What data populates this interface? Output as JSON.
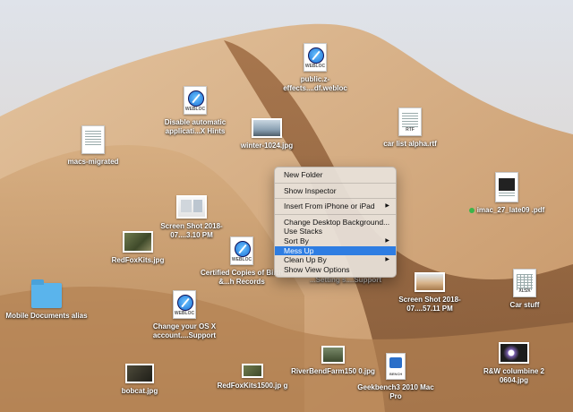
{
  "desktop": {
    "icons": [
      {
        "label": "public.z-effects....df.webloc",
        "kind": "webloc",
        "badge": "WEBLOC"
      },
      {
        "label": "Disable automatic applicati...X Hints",
        "kind": "webloc",
        "badge": "WEBLOC"
      },
      {
        "label": "winter-1024.jpg",
        "kind": "image"
      },
      {
        "label": "macs-migrated",
        "kind": "document"
      },
      {
        "label": "car list alpha.rtf",
        "kind": "document",
        "badge": "RTF"
      },
      {
        "label": "imac_27_late09 .pdf",
        "kind": "pdf",
        "tag_color": "#3bb54a"
      },
      {
        "label": "Screen Shot 2018-07....3.10 PM",
        "kind": "image"
      },
      {
        "label": "RedFoxKits.jpg",
        "kind": "image"
      },
      {
        "label": "Certified Copies of Birth &...h Records",
        "kind": "webloc",
        "badge": "WEBLOC"
      },
      {
        "label": "Mobile Documents alias",
        "kind": "folder"
      },
      {
        "label": "Screen Shot 2018-07....57.11 PM",
        "kind": "image"
      },
      {
        "label": "Car stuff",
        "kind": "document",
        "badge": "XLSX"
      },
      {
        "label": "Change your OS X account....Support",
        "kind": "webloc",
        "badge": "WEBLOC"
      },
      {
        "label": "RiverBendFarm150 0.jpg",
        "kind": "image"
      },
      {
        "label": "R&W columbine 2 0604.jpg",
        "kind": "image"
      },
      {
        "label": "bobcat.jpg",
        "kind": "image"
      },
      {
        "label": "RedFoxKits1500.jp g",
        "kind": "image"
      },
      {
        "label": "Geekbench3 2010 Mac Pro",
        "kind": "app",
        "badge": "BENCH"
      }
    ],
    "obscured_label": "...Setting s....Support"
  },
  "context_menu": {
    "items": [
      {
        "label": "New Folder",
        "submenu": false
      },
      {
        "separator": true
      },
      {
        "label": "Show Inspector",
        "submenu": false
      },
      {
        "separator": true
      },
      {
        "label": "Insert From iPhone or iPad",
        "submenu": true
      },
      {
        "separator": true
      },
      {
        "label": "Change Desktop Background...",
        "submenu": false
      },
      {
        "label": "Use Stacks",
        "submenu": false
      },
      {
        "label": "Sort By",
        "submenu": true
      },
      {
        "label": "Mess Up",
        "submenu": false,
        "highlighted": true
      },
      {
        "label": "Clean Up By",
        "submenu": true
      },
      {
        "label": "Show View Options",
        "submenu": false
      }
    ]
  },
  "colors": {
    "highlight": "#2e7de2",
    "folder": "#5ab4ec",
    "tag_green": "#3bb54a"
  }
}
